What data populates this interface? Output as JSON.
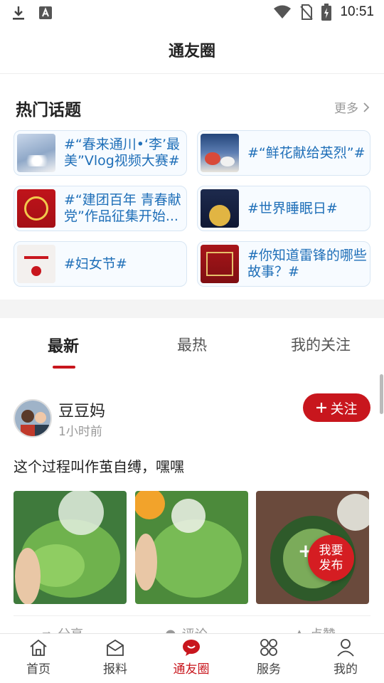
{
  "status_bar": {
    "time": "10:51"
  },
  "header": {
    "title": "通友圈"
  },
  "hot_topics": {
    "title": "热门话题",
    "more_label": "更多",
    "items": [
      {
        "label": "#“春来通川•‘李’最美”Vlog视频大赛#"
      },
      {
        "label": "#“鲜花献给英烈”#"
      },
      {
        "label": "#“建团百年 青春献党”作品征集开始..."
      },
      {
        "label": "#世界睡眠日#"
      },
      {
        "label": "#妇女节#"
      },
      {
        "label": "#你知道雷锋的哪些故事？#"
      }
    ]
  },
  "tabs": [
    {
      "label": "最新",
      "active": true
    },
    {
      "label": "最热",
      "active": false
    },
    {
      "label": "我的关注",
      "active": false
    }
  ],
  "post": {
    "user_name": "豆豆妈",
    "time": "1小时前",
    "follow_label": "关注",
    "text": "这个过程叫作茧自缚，嘿嘿",
    "actions": [
      "分享",
      "评论",
      "点赞"
    ]
  },
  "publish_button": {
    "label": "我要发布"
  },
  "bottom_nav": [
    {
      "label": "首页",
      "icon": "home-icon"
    },
    {
      "label": "报料",
      "icon": "envelope-icon"
    },
    {
      "label": "通友圈",
      "icon": "chat-bubble-icon",
      "active": true
    },
    {
      "label": "服务",
      "icon": "grid-icon"
    },
    {
      "label": "我的",
      "icon": "person-icon"
    }
  ],
  "colors": {
    "accent": "#c8161d",
    "topic_text": "#1f6fb8",
    "topic_border": "#d8e6f3"
  }
}
